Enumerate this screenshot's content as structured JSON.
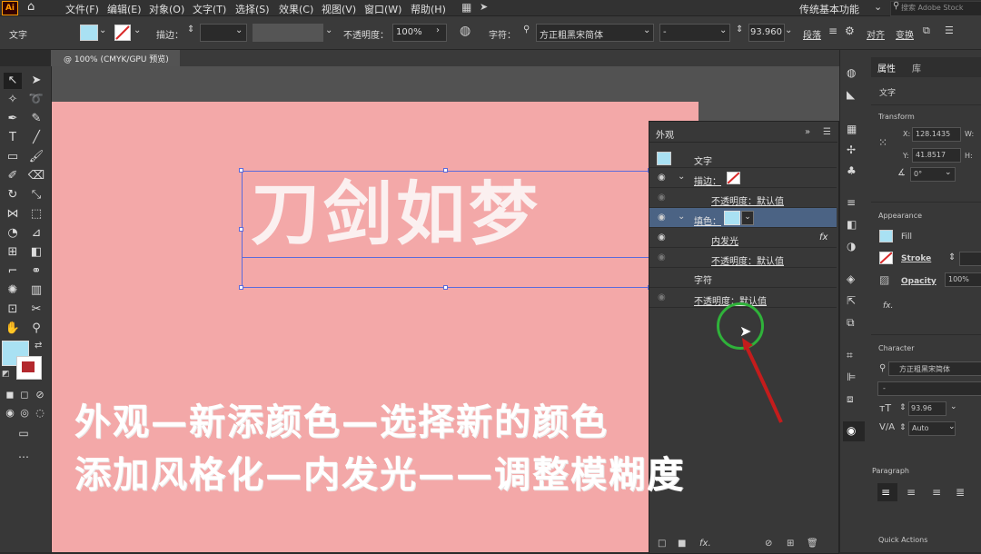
{
  "menubar": {
    "app_logo": "Ai",
    "items": [
      "文件(F)",
      "编辑(E)",
      "对象(O)",
      "文字(T)",
      "选择(S)",
      "效果(C)",
      "视图(V)",
      "窗口(W)",
      "帮助(H)"
    ],
    "workspace": "传统基本功能",
    "search_placeholder": "搜索 Adobe Stock"
  },
  "controlbar": {
    "selection_type": "文字",
    "stroke_label": "描边：",
    "opacity_label": "不透明度：",
    "opacity_value": "100%",
    "char_label": "字符：",
    "font_name": "方正粗黑宋简体",
    "font_style": "-",
    "font_size": "93.960",
    "paragraph": "段落",
    "align": "对齐",
    "transform": "变换"
  },
  "document": {
    "tab_title": "@ 100% (CMYK/GPU 预览)"
  },
  "artwork": {
    "title_text": "刀剑如梦"
  },
  "captions": {
    "line1": "外观—新添颜色—选择新的颜色",
    "line2": "添加风格化—内发光——调整模糊度"
  },
  "appearance_panel": {
    "title": "外观",
    "rows": {
      "object": "文字",
      "stroke": "描边：",
      "stroke_opacity": "不透明度：默认值",
      "fill": "填色：",
      "inner_glow": "内发光",
      "fx": "fx",
      "fill_opacity": "不透明度：默认值",
      "characters": "字符",
      "opacity": "不透明度：默认值"
    },
    "footer_fx": "fx."
  },
  "properties_panel": {
    "tab_properties": "属性",
    "tab_libraries": "库",
    "selection_type": "文字",
    "transform_heading": "Transform",
    "x_label": "X:",
    "x_value": "128.1435",
    "y_label": "Y:",
    "y_value": "41.8517",
    "w_label": "W:",
    "h_label": "H:",
    "angle_value": "0°",
    "appearance_heading": "Appearance",
    "fill_label": "Fill",
    "stroke_label": "Stroke",
    "opacity_label": "Opacity",
    "opacity_value": "100%",
    "fx_label": "fx.",
    "character_heading": "Character",
    "font_name": "方正粗黑宋简体",
    "font_style": "-",
    "font_size": "93.96",
    "tracking": "Auto",
    "paragraph_heading": "Paragraph",
    "quick_actions": "Quick Actions"
  },
  "colors": {
    "artboard": "#f3a8a8",
    "fill_swatch": "#a9e1f3",
    "stroke_red": "#b3282d",
    "selection_blue": "#5b6bdb",
    "highlight_circle": "#2fb23a",
    "selected_row": "#4b6384"
  }
}
